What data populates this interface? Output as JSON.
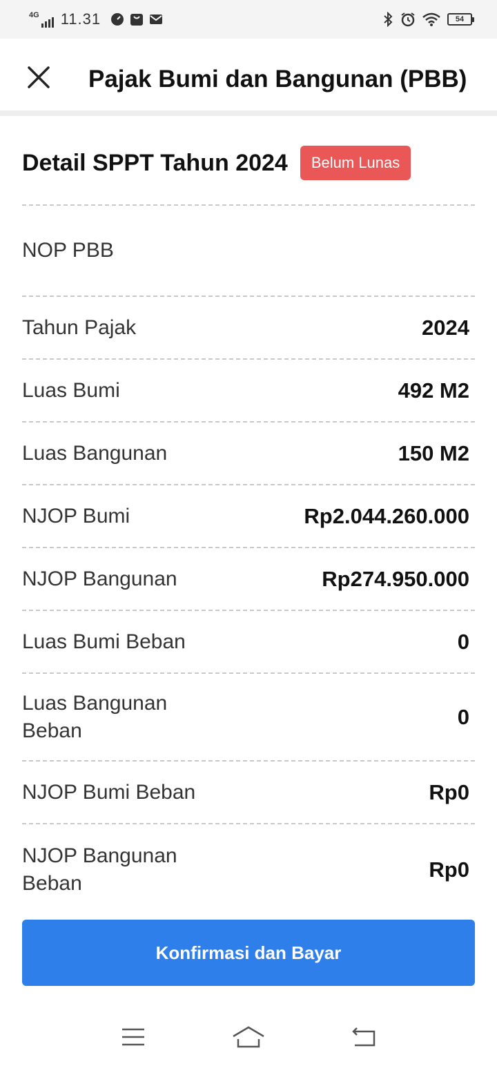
{
  "status_bar": {
    "network": "4G",
    "time": "11.31",
    "battery": "54"
  },
  "header": {
    "title": "Pajak Bumi dan Bangunan (PBB)"
  },
  "detail": {
    "title": "Detail SPPT Tahun 2024",
    "status_badge": "Belum Lunas",
    "rows": [
      {
        "label": "NOP PBB",
        "value": ""
      },
      {
        "label": "Tahun Pajak",
        "value": "2024"
      },
      {
        "label": "Luas Bumi",
        "value": "492 M2"
      },
      {
        "label": "Luas Bangunan",
        "value": "150 M2"
      },
      {
        "label": "NJOP Bumi",
        "value": "Rp2.044.260.000"
      },
      {
        "label": "NJOP Bangunan",
        "value": "Rp274.950.000"
      },
      {
        "label": "Luas Bumi Beban",
        "value": "0"
      },
      {
        "label": "Luas Bangunan Beban",
        "value": "0"
      },
      {
        "label": "NJOP Bumi Beban",
        "value": "Rp0"
      },
      {
        "label": "NJOP Bangunan Beban",
        "value": "Rp0"
      }
    ]
  },
  "actions": {
    "pay_label": "Konfirmasi dan Bayar"
  },
  "colors": {
    "accent": "#2f7fea",
    "badge": "#ea5757"
  },
  "icons": {
    "close": "close-icon",
    "menu": "menu-icon",
    "home": "home-icon",
    "back": "back-icon"
  }
}
